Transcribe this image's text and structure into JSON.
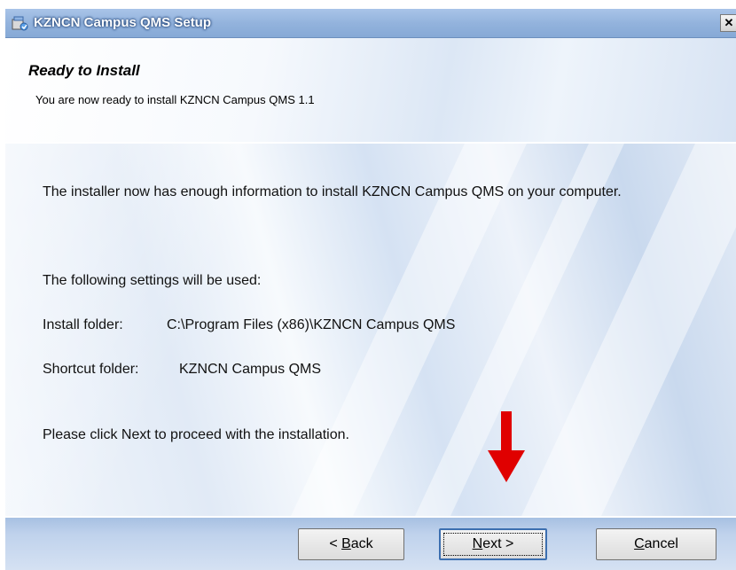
{
  "window": {
    "title": "KZNCN Campus QMS Setup",
    "close_glyph": "✕"
  },
  "header": {
    "title": "Ready to Install",
    "subtitle": "You are now ready to install KZNCN Campus QMS 1.1"
  },
  "content": {
    "intro": "The installer now has enough information to install KZNCN Campus QMS on your computer.",
    "settings_heading": "The following settings will be used:",
    "install_folder_label": "Install folder:",
    "install_folder_value": "C:\\Program Files (x86)\\KZNCN Campus QMS",
    "shortcut_folder_label": "Shortcut folder:",
    "shortcut_folder_value": "KZNCN Campus QMS",
    "instruction": "Please click Next to proceed with the installation."
  },
  "buttons": {
    "back": {
      "prefix": "< ",
      "accel": "B",
      "rest": "ack"
    },
    "next": {
      "accel": "N",
      "rest": "ext >"
    },
    "cancel": {
      "accel": "C",
      "rest": "ancel"
    }
  },
  "annotation": {
    "arrow_color": "#e00000"
  },
  "colors": {
    "titlebar": "#93b3dd",
    "focus_border": "#3c6fb0"
  },
  "icons": {
    "app": "installer-icon",
    "close": "close-icon",
    "pointer": "red-arrow-icon"
  }
}
